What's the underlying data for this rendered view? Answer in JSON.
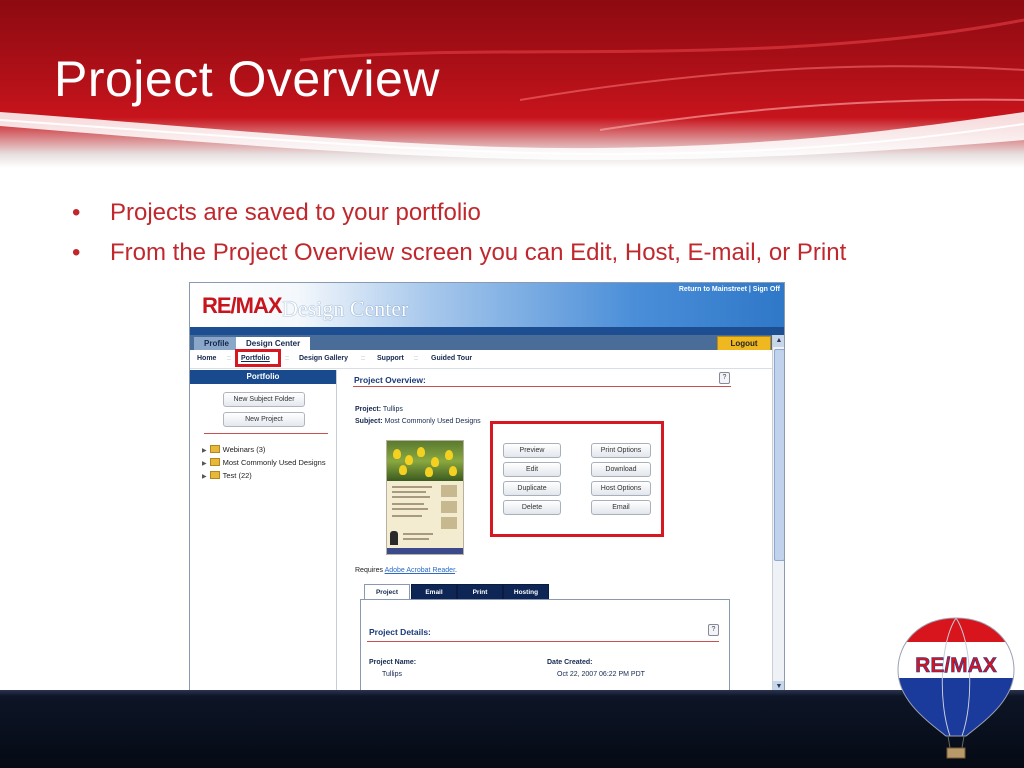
{
  "slide": {
    "title": "Project Overview",
    "bullets": [
      "Projects are saved to your portfolio",
      "From the Project Overview screen you can Edit, Host, E-mail, or Print"
    ]
  },
  "app": {
    "logo_main": "RE/MAX",
    "logo_sub": "Design Center",
    "top_links": "Return to Mainstreet | Sign Off",
    "tabs": [
      {
        "label": "Profile"
      },
      {
        "label": "Design Center"
      }
    ],
    "logout_label": "Logout",
    "nav": [
      {
        "label": "Home"
      },
      {
        "label": "Portfolio"
      },
      {
        "label": "Design Gallery"
      },
      {
        "label": "Support"
      },
      {
        "label": "Guided Tour"
      }
    ],
    "nav_separator": "::",
    "sidebar": {
      "title": "Portfolio",
      "new_folder_label": "New Subject Folder",
      "new_project_label": "New Project",
      "tree": [
        {
          "label": "Webinars (3)"
        },
        {
          "label": "Most Commonly Used Designs"
        },
        {
          "label": "Test (22)"
        }
      ]
    },
    "overview": {
      "title": "Project Overview:",
      "help": "?",
      "project_label": "Project:",
      "project_value": "Tullips",
      "subject_label": "Subject:",
      "subject_value": "Most Commonly Used Designs",
      "actions_left": [
        "Preview",
        "Edit",
        "Duplicate",
        "Delete"
      ],
      "actions_right": [
        "Print Options",
        "Download",
        "Host Options",
        "Email"
      ],
      "requires_text": "Requires",
      "requires_link": "Adobe Acrobat Reader",
      "requires_end": "."
    },
    "bottom_tabs": [
      "Project",
      "Email",
      "Print",
      "Hosting"
    ],
    "details": {
      "title": "Project Details:",
      "help": "?",
      "project_name_label": "Project Name:",
      "project_name_value": "Tullips",
      "date_created_label": "Date Created:",
      "date_created_value": "Oct 22, 2007 06:22 PM PDT"
    }
  },
  "colors": {
    "header_red": "#b01018",
    "bullet_text": "#c0282e",
    "highlight_red": "#d81820",
    "app_navy": "#1a4a8e",
    "logout_gold": "#f0b820"
  },
  "icons": [
    "folder-icon",
    "tree-arrow-icon",
    "help-icon",
    "scroll-up-icon",
    "scroll-down-icon",
    "remax-balloon-icon"
  ]
}
